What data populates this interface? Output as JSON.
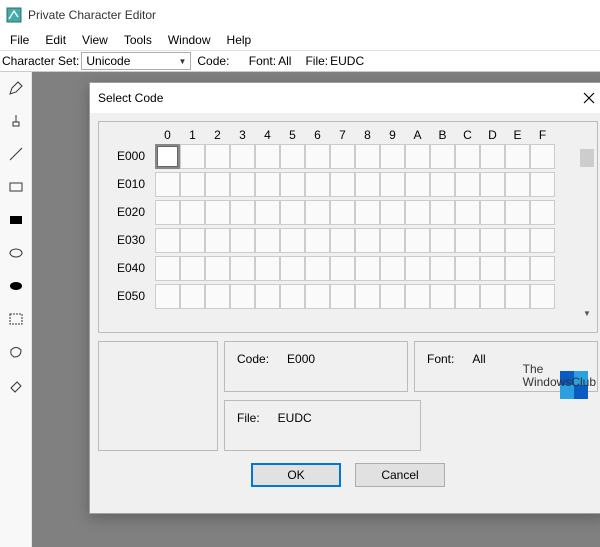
{
  "window": {
    "title": "Private Character Editor"
  },
  "menu": [
    "File",
    "Edit",
    "View",
    "Tools",
    "Window",
    "Help"
  ],
  "infobar": {
    "charset_label": "Character Set:",
    "charset_value": "Unicode",
    "code_label": "Code:",
    "font_label": "Font:",
    "font_value": "All",
    "file_label": "File:",
    "file_value": "EUDC"
  },
  "dialog": {
    "title": "Select Code",
    "col_headers": [
      "0",
      "1",
      "2",
      "3",
      "4",
      "5",
      "6",
      "7",
      "8",
      "9",
      "A",
      "B",
      "C",
      "D",
      "E",
      "F"
    ],
    "row_headers": [
      "E000",
      "E010",
      "E020",
      "E030",
      "E040",
      "E050"
    ],
    "selected_row": 0,
    "selected_col": 0,
    "code_label": "Code:",
    "code_value": "E000",
    "font_label": "Font:",
    "font_value": "All",
    "file_label": "File:",
    "file_value": "EUDC",
    "ok_label": "OK",
    "cancel_label": "Cancel"
  },
  "watermark": {
    "line1": "The",
    "line2": "WindowsClub"
  }
}
